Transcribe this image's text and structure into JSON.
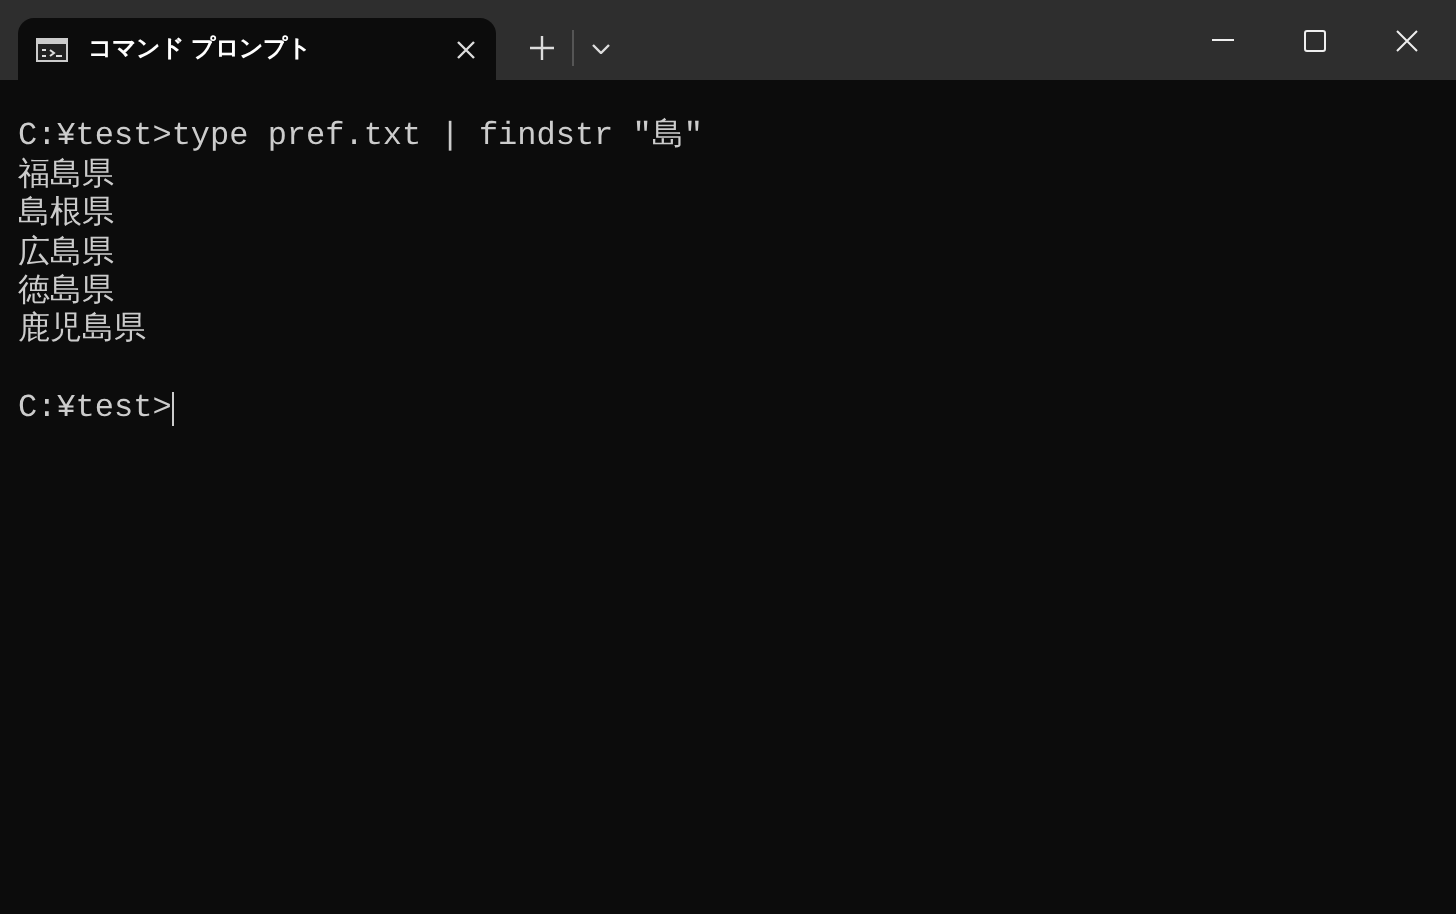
{
  "tabs": [
    {
      "title": "コマンド プロンプト",
      "selected": true
    }
  ],
  "terminal": {
    "lines": [
      {
        "kind": "blank"
      },
      {
        "kind": "command",
        "text": "C:¥test>type pref.txt | findstr \"島\""
      },
      {
        "kind": "output",
        "text": "福島県"
      },
      {
        "kind": "output",
        "text": "島根県"
      },
      {
        "kind": "output",
        "text": "広島県"
      },
      {
        "kind": "output",
        "text": "徳島県"
      },
      {
        "kind": "output",
        "text": "鹿児島県"
      },
      {
        "kind": "blank"
      },
      {
        "kind": "prompt",
        "text": "C:¥test>"
      }
    ]
  }
}
